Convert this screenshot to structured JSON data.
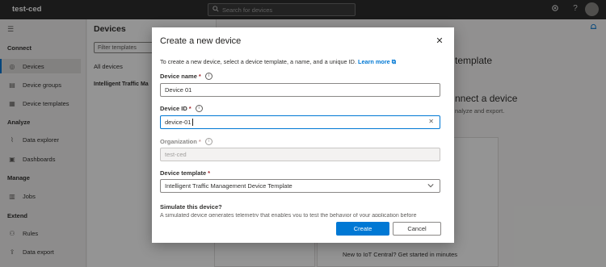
{
  "app": {
    "title": "test-ced"
  },
  "search": {
    "placeholder": "Search for devices"
  },
  "topbar": {
    "settings_icon": "gear-icon",
    "help_icon": "?"
  },
  "sidebar": {
    "sections": [
      {
        "label": "Connect"
      },
      {
        "label": "Analyze"
      },
      {
        "label": "Manage"
      },
      {
        "label": "Extend"
      }
    ],
    "items": [
      {
        "label": "Devices",
        "icon": "devices-icon"
      },
      {
        "label": "Device groups",
        "icon": "device-groups-icon"
      },
      {
        "label": "Device templates",
        "icon": "device-templates-icon"
      },
      {
        "label": "Data explorer",
        "icon": "data-explorer-icon"
      },
      {
        "label": "Dashboards",
        "icon": "dashboards-icon"
      },
      {
        "label": "Jobs",
        "icon": "jobs-icon"
      },
      {
        "label": "Rules",
        "icon": "rules-icon"
      },
      {
        "label": "Data export",
        "icon": "data-export-icon"
      }
    ]
  },
  "devices_panel": {
    "title": "Devices",
    "filter_placeholder": "Filter templates",
    "all_devices": "All devices",
    "template_item": "Intelligent Traffic Ma"
  },
  "background": {
    "heading1": "template",
    "heading2": "nnect a device",
    "sub": "nalyze and export.",
    "footer": "New to IoT Central? Get started in minutes"
  },
  "dialog": {
    "title": "Create a new device",
    "intro": "To create a new device, select a device template, a name, and a unique ID.",
    "learn_more": "Learn more",
    "device_name_label": "Device name",
    "device_name_value": "Device 01",
    "device_id_label": "Device ID",
    "device_id_value": "device-01",
    "organization_label": "Organization",
    "organization_value": "test-ced",
    "template_label": "Device template",
    "template_value": "Intelligent Traffic Management Device Template",
    "simulate_label": "Simulate this device?",
    "simulate_desc": "A simulated device generates telemetry that enables you to test the behavior of your application before",
    "create_label": "Create",
    "cancel_label": "Cancel"
  },
  "colors": {
    "accent": "#0078d4",
    "topbar": "#2d2d2d",
    "required": "#a4262c"
  }
}
